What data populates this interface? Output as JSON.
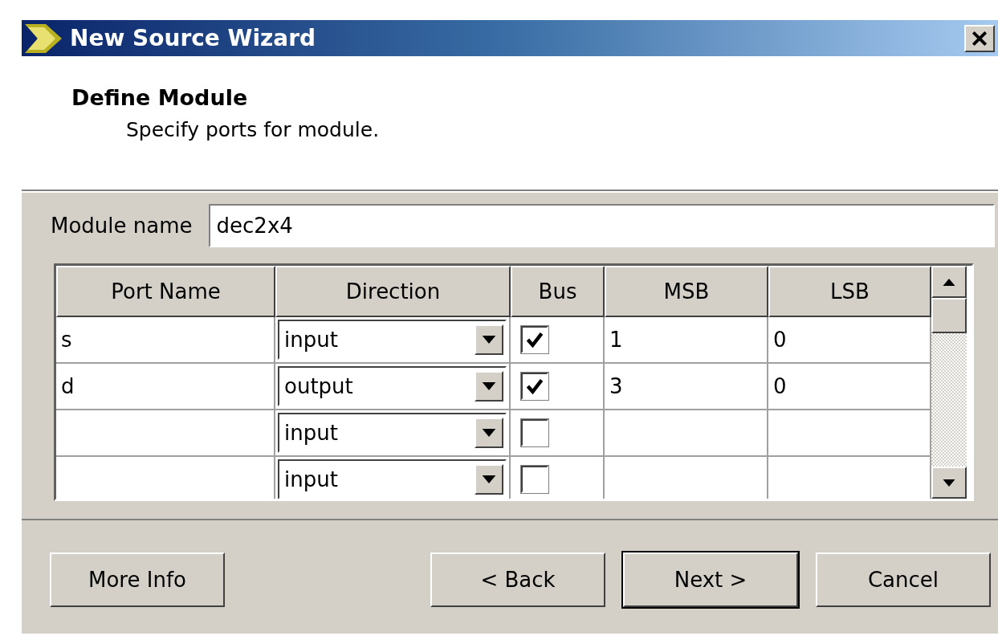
{
  "window": {
    "title": "New Source Wizard"
  },
  "header": {
    "title": "Define Module",
    "subtitle": "Specify ports for module."
  },
  "module_name": {
    "label": "Module name",
    "value": "dec2x4"
  },
  "table": {
    "columns": [
      "Port Name",
      "Direction",
      "Bus",
      "MSB",
      "LSB"
    ],
    "rows": [
      {
        "port_name": "s",
        "direction": "input",
        "bus": true,
        "msb": "1",
        "lsb": "0"
      },
      {
        "port_name": "d",
        "direction": "output",
        "bus": true,
        "msb": "3",
        "lsb": "0"
      },
      {
        "port_name": "",
        "direction": "input",
        "bus": false,
        "msb": "",
        "lsb": ""
      },
      {
        "port_name": "",
        "direction": "input",
        "bus": false,
        "msb": "",
        "lsb": ""
      }
    ]
  },
  "buttons": [
    {
      "label": "More Info",
      "default": false
    },
    {
      "label": "< Back",
      "default": false
    },
    {
      "label": "Next >",
      "default": true
    },
    {
      "label": "Cancel",
      "default": false
    }
  ]
}
